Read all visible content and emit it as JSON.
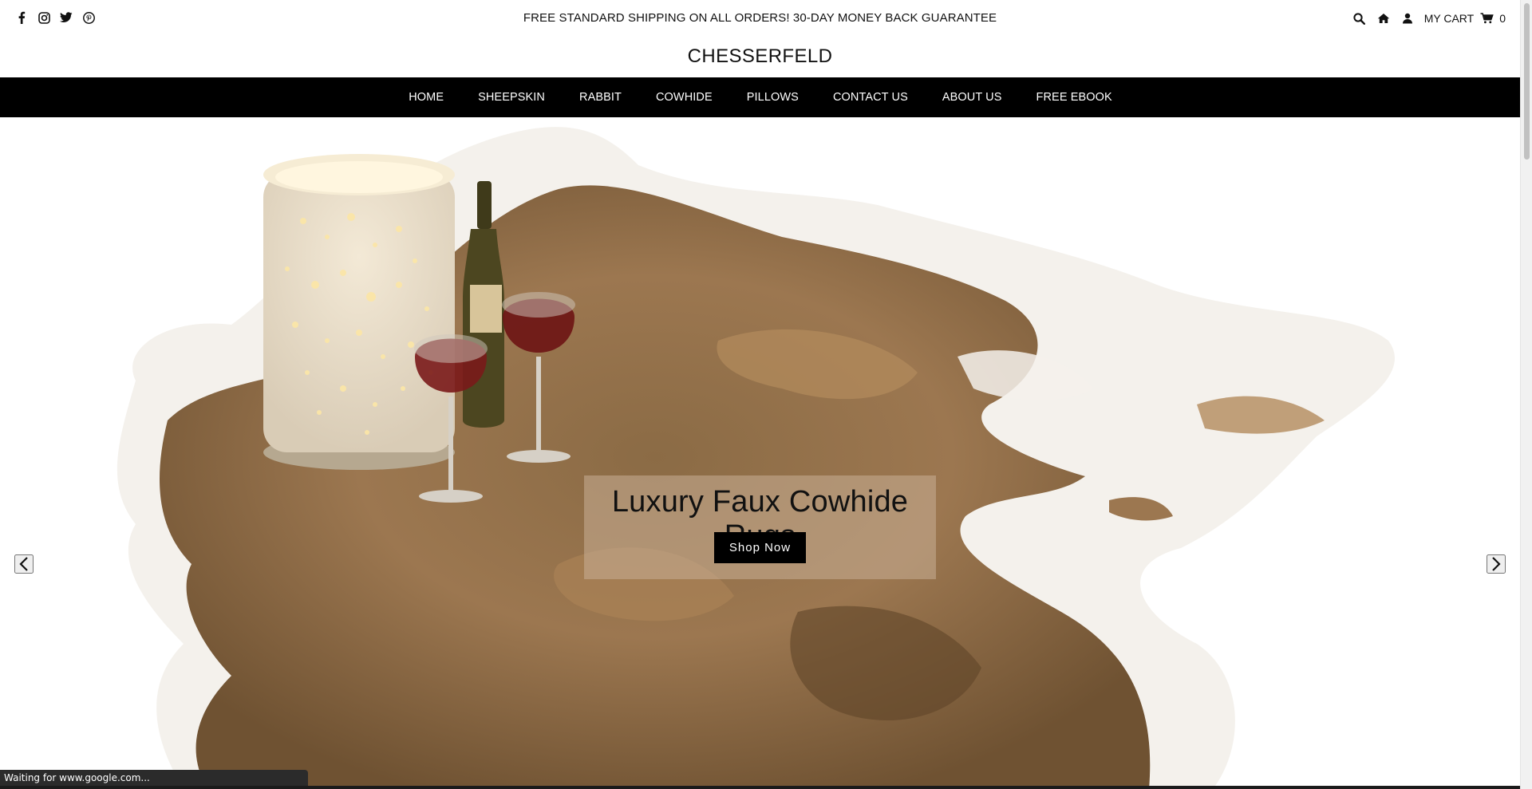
{
  "topbar": {
    "social_icons": [
      "facebook-icon",
      "instagram-icon",
      "twitter-icon",
      "pinterest-icon"
    ],
    "promo_text": "FREE STANDARD SHIPPING ON ALL ORDERS! 30-DAY MONEY BACK GUARANTEE",
    "tools": [
      "search-icon",
      "home-icon",
      "user-icon"
    ],
    "cart_label": "MY CART",
    "cart_count": "0"
  },
  "brand": {
    "name": "CHESSERFELD"
  },
  "nav": {
    "items": [
      {
        "label": "HOME"
      },
      {
        "label": "SHEEPSKIN"
      },
      {
        "label": "RABBIT"
      },
      {
        "label": "COWHIDE"
      },
      {
        "label": "PILLOWS"
      },
      {
        "label": "CONTACT US"
      },
      {
        "label": "ABOUT US"
      },
      {
        "label": "FREE EBOOK"
      }
    ]
  },
  "hero": {
    "title": "Luxury Faux Cowhide Rugs",
    "button_label": "Shop Now",
    "prev_icon": "chevron-left-icon",
    "next_icon": "chevron-right-icon"
  },
  "status": {
    "text": "Waiting for www.google.com..."
  },
  "colors": {
    "nav_bg": "#000000",
    "accent": "#000000",
    "caption_bg": "#c8af96"
  }
}
